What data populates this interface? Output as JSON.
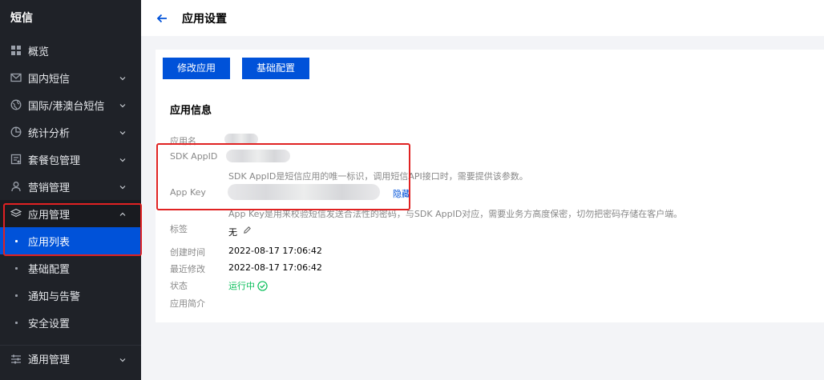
{
  "sidebar": {
    "title": "短信",
    "items": [
      {
        "label": "概览",
        "icon": "grid-icon"
      },
      {
        "label": "国内短信",
        "icon": "mail-icon"
      },
      {
        "label": "国际/港澳台短信",
        "icon": "globe-icon"
      },
      {
        "label": "统计分析",
        "icon": "pie-chart-icon"
      },
      {
        "label": "套餐包管理",
        "icon": "package-icon"
      },
      {
        "label": "营销管理",
        "icon": "user-icon"
      },
      {
        "label": "应用管理",
        "icon": "layers-icon"
      }
    ],
    "sub_items": [
      {
        "label": "应用列表"
      },
      {
        "label": "基础配置"
      },
      {
        "label": "通知与告警"
      },
      {
        "label": "安全设置"
      }
    ],
    "bottom_item": {
      "label": "通用管理",
      "icon": "sliders-icon"
    }
  },
  "header": {
    "title": "应用设置"
  },
  "toolbar": {
    "edit_label": "修改应用",
    "config_label": "基础配置"
  },
  "info": {
    "section_title": "应用信息",
    "app_name_label": "应用名",
    "sdk_appid_label": "SDK AppID",
    "sdk_appid_hint": "SDK AppID是短信应用的唯一标识，调用短信API接口时，需要提供该参数。",
    "app_key_label": "App Key",
    "hide_label": "隐藏",
    "app_key_hint": "App Key是用来校验短信发送合法性的密码，与SDK AppID对应，需要业务方高度保密，切勿把密码存储在客户端。",
    "tag_label": "标签",
    "tag_value": "无",
    "created_label": "创建时间",
    "created_value": "2022-08-17 17:06:42",
    "modified_label": "最近修改",
    "modified_value": "2022-08-17 17:06:42",
    "status_label": "状态",
    "status_value": "运行中",
    "desc_label": "应用简介"
  },
  "colors": {
    "accent": "#0052d9",
    "sidebar_bg": "#1f2228",
    "status_green": "#0abf5b",
    "highlight_red": "#e02222"
  }
}
